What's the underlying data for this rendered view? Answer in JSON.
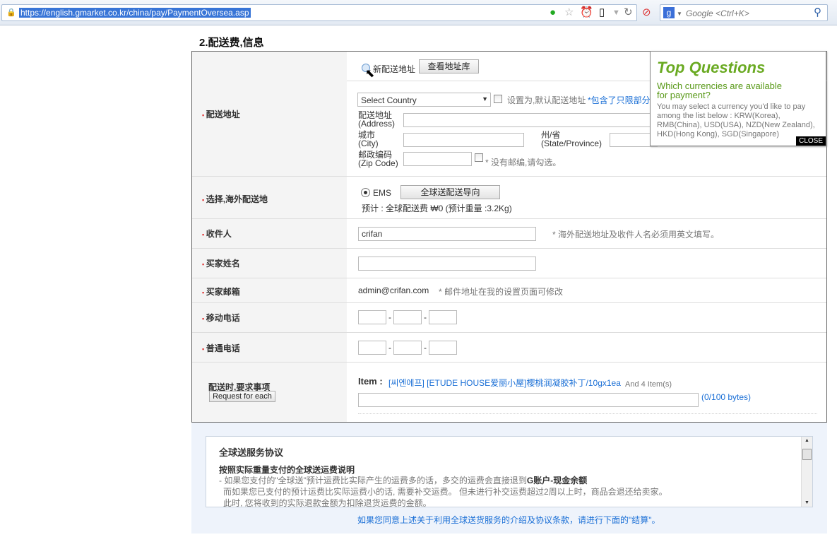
{
  "browser": {
    "url": "https://english.gmarket.co.kr/china/pay/PaymentOversea.asp",
    "search_placeholder": "Google <Ctrl+K>"
  },
  "section_title": "2.配送费,信息",
  "address": {
    "label": "配送地址",
    "new_address": "新配送地址",
    "view_book": "查看地址库",
    "country": "Select Country",
    "set_default": "设置为,默认配送地址",
    "notice_link": "*包含了只限部分国",
    "addr_label": "配送地址",
    "addr_en": "(Address)",
    "city_label": "城市",
    "city_en": "(City)",
    "state_label": "州/省",
    "state_en": "(State/Province)",
    "zip_label": "邮政编码",
    "zip_en": "(Zip Code)",
    "no_zip": "* 没有邮编,请勾选。"
  },
  "shipping": {
    "label": "选择,海外配送地",
    "method": "EMS",
    "guide": "全球送配送导向",
    "estimate": "预计 : 全球配送费 ₩0 (预计重量 :3.2Kg)"
  },
  "recipient": {
    "label": "收件人",
    "value": "crifan",
    "note": "* 海外配送地址及收件人名必须用英文填写。"
  },
  "buyer_name": {
    "label": "买家姓名",
    "value": ""
  },
  "buyer_email": {
    "label": "买家邮箱",
    "value": "admin@crifan.com",
    "note": "* 邮件地址在我的设置页面可修改"
  },
  "mobile": {
    "label": "移动电话",
    "sep": "-"
  },
  "phone": {
    "label": "普通电话",
    "sep": "-"
  },
  "request": {
    "label": "配送时,要求事项",
    "button": "Request for each",
    "item_label": "Item :",
    "item": "[씨엔에프] [ETUDE HOUSE爱丽小屋]樱桃润凝胶补丁/10gx1ea",
    "more": "And 4 Item(s)",
    "count_open": "(",
    "count": "0",
    "count_close": "/100 bytes)"
  },
  "popup": {
    "title": "Top Questions",
    "question": "Which currencies are available for payment?",
    "answer": "You may select a currency you'd like to pay among the list below : KRW(Korea), RMB(China), USD(USA), NZD(New Zealand), HKD(Hong Kong), SGD(Singapore)",
    "close": "CLOSE"
  },
  "agreement": {
    "title": "全球送服务协议",
    "subtitle": "按照实际重量支付的全球送运费说明",
    "line1": "- 如果您支付的\"全球送\"预计运费比实际产生的运费多的话，多交的运费会直接退到",
    "line1_bold": "G账户-现金余额",
    "line2": "而如果您已支付的预计运费比实际运费小的话, 需要补交运费。 但未进行补交运费超过2周以上时，商品会退还给卖家。",
    "line3": "此时, 您将收到的实际退款金额为扣除退货运费的金额。",
    "confirm": "如果您同意上述关于利用全球送货服务的介绍及协议条款，请进行下面的\"结算\"。"
  }
}
